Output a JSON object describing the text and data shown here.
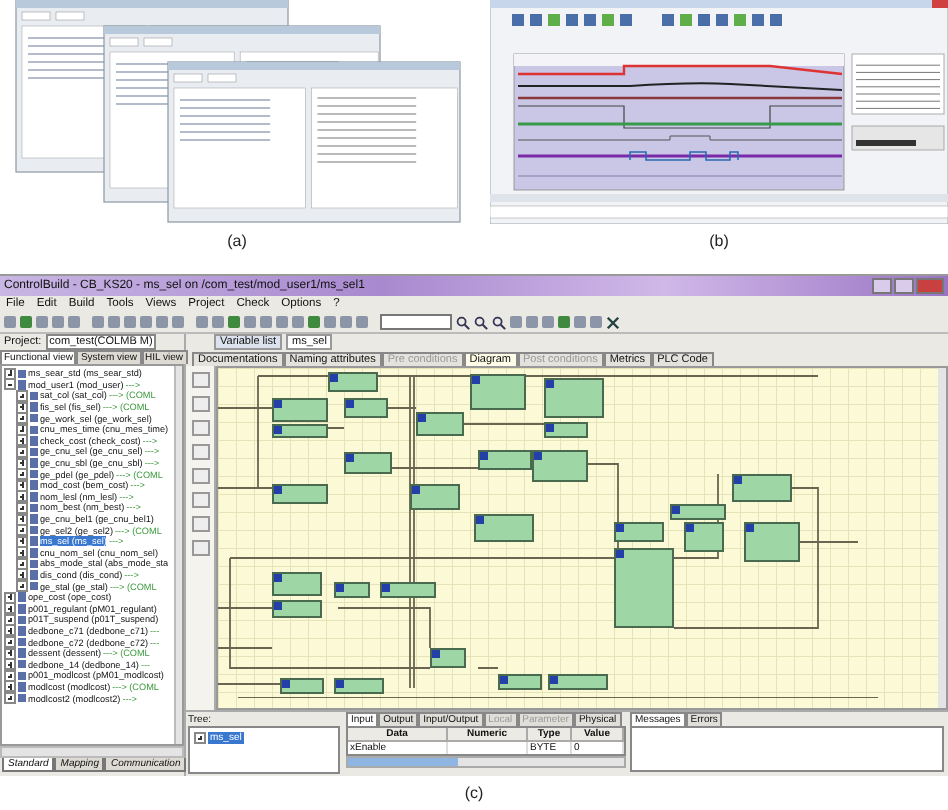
{
  "panel_a": {
    "caption": "(a)"
  },
  "panel_b": {
    "caption": "(b)"
  },
  "panel_c": {
    "caption": "(c)",
    "window": {
      "title": "ControlBuild - CB_KS20 - ms_sel on /com_test/mod_user1/ms_sel1"
    },
    "menu": [
      "File",
      "Edit",
      "Build",
      "Tools",
      "Views",
      "Project",
      "Check",
      "Options",
      "?"
    ],
    "project": {
      "label": "Project:",
      "value": "com_test(COLMB M)"
    },
    "view_tabs": [
      {
        "label": "Functional view",
        "selected": true
      },
      {
        "label": "System view",
        "selected": false
      },
      {
        "label": "HIL view",
        "selected": false
      }
    ],
    "tree": [
      {
        "label": "ms_sear_std (ms_sear_std)",
        "expanded": false,
        "selected": false
      },
      {
        "label": "mod_user1 (mod_user)",
        "link": "--->",
        "expanded": true,
        "selected": false,
        "children": [
          {
            "label": "sat_col (sat_col)",
            "link": "---> (COML",
            "expanded": false,
            "selected": false
          },
          {
            "label": "fis_sel (fis_sel)",
            "link": "---> (COML",
            "expanded": false,
            "selected": false
          },
          {
            "label": "ge_work_sel (ge_work_sel)",
            "expanded": false,
            "selected": false
          },
          {
            "label": "cnu_mes_time (cnu_mes_time)",
            "expanded": false,
            "selected": false
          },
          {
            "label": "check_cost (check_cost)",
            "link": "--->",
            "expanded": false,
            "selected": false
          },
          {
            "label": "ge_cnu_sel (ge_cnu_sel)",
            "link": "--->",
            "expanded": false,
            "selected": false
          },
          {
            "label": "ge_cnu_sbl (ge_cnu_sbl)",
            "link": "--->",
            "expanded": false,
            "selected": false
          },
          {
            "label": "ge_pdel (ge_pdel)",
            "link": "---> (COML",
            "expanded": false,
            "selected": false
          },
          {
            "label": "mod_cost (bem_cost)",
            "link": "--->",
            "expanded": false,
            "selected": false
          },
          {
            "label": "nom_lesl (nm_lesl)",
            "link": "--->",
            "expanded": false,
            "selected": false
          },
          {
            "label": "nom_best (nm_best)",
            "link": "--->",
            "expanded": false,
            "selected": false
          },
          {
            "label": "ge_cnu_bel1 (ge_cnu_bel1)",
            "expanded": false,
            "selected": false
          },
          {
            "label": "ge_sel2 (ge_sel2)",
            "link": "---> (COML",
            "expanded": false,
            "selected": false
          },
          {
            "label": "ms_sel (ms_sel)",
            "link": "--->",
            "expanded": false,
            "selected": true
          },
          {
            "label": "cnu_nom_sel (cnu_nom_sel)",
            "expanded": false,
            "selected": false
          },
          {
            "label": "abs_mode_stal (abs_mode_sta",
            "expanded": false,
            "selected": false
          },
          {
            "label": "dis_cond (dis_cond)",
            "link": "--->",
            "expanded": false,
            "selected": false
          },
          {
            "label": "ge_stal (ge_stal)",
            "link": "---> (COML",
            "expanded": false,
            "selected": false
          }
        ]
      },
      {
        "label": "ope_cost (ope_cost)",
        "expanded": false,
        "selected": false
      },
      {
        "label": "p001_regulant (pM01_regulant)",
        "expanded": false,
        "selected": false
      },
      {
        "label": "p01T_suspend (p01T_suspend)",
        "expanded": false,
        "selected": false
      },
      {
        "label": "dedbone_c71 (dedbone_c71)",
        "link": "---",
        "expanded": false,
        "selected": false
      },
      {
        "label": "dedbone_c72 (dedbone_c72)",
        "link": "---",
        "expanded": false,
        "selected": false
      },
      {
        "label": "dessent (dessent)",
        "link": "---> (COML",
        "expanded": false,
        "selected": false
      },
      {
        "label": "dedbone_14 (dedbone_14)",
        "link": "---",
        "expanded": false,
        "selected": false
      },
      {
        "label": "p001_modlcost (pM01_modlcost)",
        "expanded": false,
        "selected": false
      },
      {
        "label": "modlcost (modlcost)",
        "link": "---> (COML",
        "expanded": false,
        "selected": false
      },
      {
        "label": "modlcost2 (modlcost2)",
        "link": "--->",
        "expanded": false,
        "selected": false
      }
    ],
    "bottom_tabs": [
      {
        "label": "Standard",
        "selected": true
      },
      {
        "label": "Mapping",
        "selected": false
      },
      {
        "label": "Communication",
        "selected": false
      }
    ],
    "editor_tabs": [
      {
        "label": "Variable list",
        "selected": false
      },
      {
        "label": "ms_sel",
        "selected": true
      }
    ],
    "doc_tabs": [
      {
        "label": "Documentations",
        "selected": false,
        "disabled": false
      },
      {
        "label": "Naming attributes",
        "selected": false,
        "disabled": false
      },
      {
        "label": "Pre conditions",
        "selected": false,
        "disabled": true
      },
      {
        "label": "Diagram",
        "selected": true,
        "disabled": false
      },
      {
        "label": "Post conditions",
        "selected": false,
        "disabled": true
      },
      {
        "label": "Metrics",
        "selected": false,
        "disabled": false
      },
      {
        "label": "PLC Code",
        "selected": false,
        "disabled": false
      }
    ],
    "tree_box": {
      "label": "Tree:",
      "item": "ms_sel"
    },
    "property_tabs": [
      {
        "label": "Input",
        "selected": true,
        "disabled": false
      },
      {
        "label": "Output",
        "selected": false,
        "disabled": false
      },
      {
        "label": "Input/Output",
        "selected": false,
        "disabled": false
      },
      {
        "label": "Local",
        "selected": false,
        "disabled": true
      },
      {
        "label": "Parameter",
        "selected": false,
        "disabled": true
      },
      {
        "label": "Physical",
        "selected": false,
        "disabled": false
      }
    ],
    "property_table": {
      "columns": [
        "Data",
        "Numeric",
        "Type",
        "Value"
      ],
      "rows": [
        [
          "xEnable",
          null,
          "BYTE",
          "0"
        ]
      ]
    },
    "message_tabs": [
      {
        "label": "Messages",
        "selected": true
      },
      {
        "label": "Errors",
        "selected": false
      }
    ]
  }
}
